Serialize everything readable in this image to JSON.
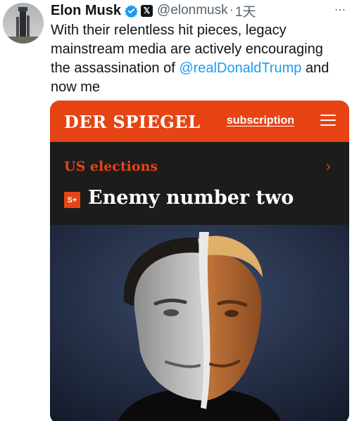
{
  "tweet": {
    "author_name": "Elon Musk",
    "handle": "@elonmusk",
    "separator": "·",
    "time": "1天",
    "more_icon": "more-dots-icon",
    "text_before": "With their relentless hit pieces, legacy mainstream media are actively  encouraging the assassination of ",
    "mention": "@realDonaldTrump",
    "text_after": " and now me",
    "colors": {
      "link": "#1d9bf0",
      "verified": "#1d9bf0",
      "secondary": "#536471"
    }
  },
  "card": {
    "logo": "DER SPIEGEL",
    "subscription_link": "subscription",
    "section": "US elections",
    "chevron": "›",
    "badge": "S+",
    "headline": "Enemy number two",
    "colors": {
      "brand": "#e64415",
      "dark": "#1c1c1c"
    }
  }
}
